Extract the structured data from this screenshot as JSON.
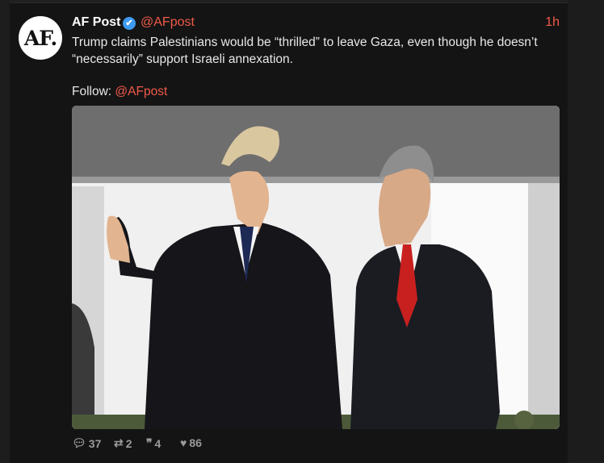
{
  "tweet": {
    "avatar_text": "AF.",
    "author_name": "AF Post",
    "verified_icon": "✔",
    "handle": "@AFpost",
    "time": "1h",
    "text": "Trump claims Palestinians would be “thrilled” to leave Gaza, even though he doesn’t “necessarily” support Israeli annexation.",
    "follow_label": "Follow: ",
    "follow_link": "@AFpost",
    "image_alt": "Two men in dark suits walking along a white colonnade, one waving"
  },
  "actions": {
    "replies": "37",
    "retweets": "2",
    "quotes": "4",
    "likes": "86"
  },
  "colors": {
    "accent": "#f05a4a",
    "background": "#141414",
    "text": "#e8e8e8",
    "verified": "#3d9af0"
  }
}
